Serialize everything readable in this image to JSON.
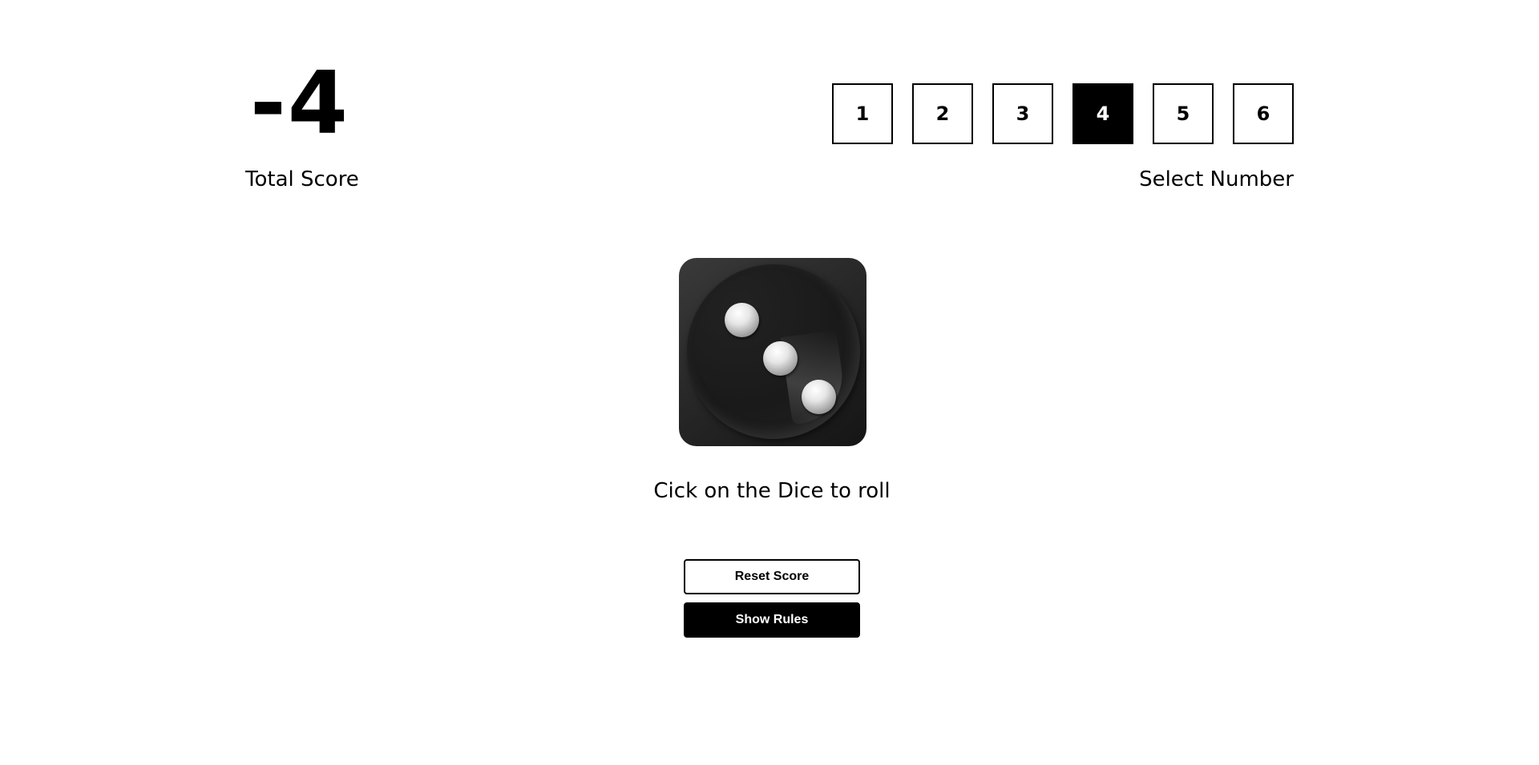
{
  "score": {
    "value": "-4",
    "label": "Total Score"
  },
  "number_selector": {
    "numbers": [
      "1",
      "2",
      "3",
      "4",
      "5",
      "6"
    ],
    "selected": "4",
    "label": "Select Number"
  },
  "dice": {
    "current_face": 3,
    "hint": "Cick on the Dice to roll"
  },
  "buttons": {
    "reset_label": "Reset Score",
    "rules_label": "Show Rules"
  },
  "colors": {
    "background": "#ffffff",
    "foreground": "#000000",
    "selected_bg": "#000000",
    "selected_fg": "#ffffff"
  }
}
